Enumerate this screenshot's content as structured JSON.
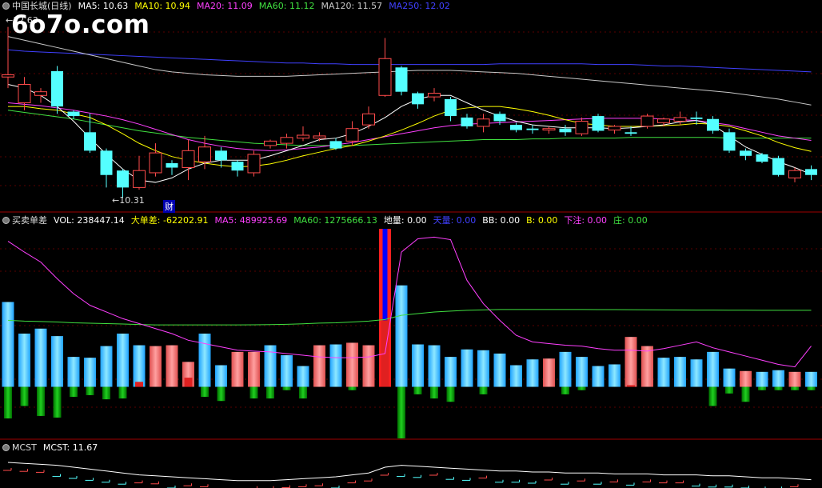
{
  "watermark": "6o7o.com",
  "colors": {
    "up": "#ff4b4b",
    "down": "#54ffff",
    "ma5": "#ffffff",
    "ma10": "#ffff00",
    "ma20": "#ff40ff",
    "ma60": "#40e040",
    "ma120": "#c8c8c8",
    "ma250": "#4040ff",
    "separator": "#a00000",
    "grid": "#5a0000"
  },
  "price_panel": {
    "stock": "中国长城(日线)",
    "indicators": [
      {
        "label": "MA5: 10.63",
        "color": "#ffffff"
      },
      {
        "label": "MA10: 10.94",
        "color": "#ffff00"
      },
      {
        "label": "MA20: 11.09",
        "color": "#ff40ff"
      },
      {
        "label": "MA60: 11.12",
        "color": "#40e040"
      },
      {
        "label": "MA120: 11.57",
        "color": "#c8c8c8"
      },
      {
        "label": "MA250: 12.02",
        "color": "#4040ff"
      }
    ],
    "high_label": "12.63",
    "low_label": "10.31",
    "event_marker": "财"
  },
  "volume_panel": {
    "name": "买卖单差",
    "indicators": [
      {
        "label": "VOL: 238447.14",
        "color": "#ffffff"
      },
      {
        "label": "大单差: -62202.91",
        "color": "#ffff00"
      },
      {
        "label": "MA5: 489925.69",
        "color": "#ff40ff"
      },
      {
        "label": "MA60: 1275666.13",
        "color": "#40e040"
      },
      {
        "label": "地量: 0.00",
        "color": "#ffffff"
      },
      {
        "label": "天量: 0.00",
        "color": "#4040ff"
      },
      {
        "label": "BB: 0.00",
        "color": "#ffffff"
      },
      {
        "label": "B: 0.00",
        "color": "#ffff00"
      },
      {
        "label": "下注: 0.00",
        "color": "#ff40ff"
      },
      {
        "label": "庄: 0.00",
        "color": "#40e040"
      }
    ]
  },
  "mcst_panel": {
    "name": "MCST",
    "indicators": [
      {
        "label": "MCST: 11.67",
        "color": "#ffffff"
      }
    ]
  },
  "chart_data": {
    "type": "candlestick",
    "price_range": [
      10.15,
      12.8
    ],
    "candles": [
      {
        "o": 11.95,
        "c": 11.98,
        "h": 12.63,
        "l": 11.8,
        "up": true
      },
      {
        "o": 11.6,
        "c": 11.85,
        "h": 11.95,
        "l": 11.5,
        "up": true
      },
      {
        "o": 11.7,
        "c": 11.75,
        "h": 11.8,
        "l": 11.6,
        "up": true
      },
      {
        "o": 12.03,
        "c": 11.55,
        "h": 12.1,
        "l": 11.45,
        "up": false
      },
      {
        "o": 11.48,
        "c": 11.42,
        "h": 11.5,
        "l": 11.38,
        "up": false
      },
      {
        "o": 11.2,
        "c": 10.95,
        "h": 11.45,
        "l": 10.92,
        "up": false
      },
      {
        "o": 10.95,
        "c": 10.62,
        "h": 10.98,
        "l": 10.45,
        "up": false
      },
      {
        "o": 10.68,
        "c": 10.45,
        "h": 10.7,
        "l": 10.31,
        "up": false
      },
      {
        "o": 10.45,
        "c": 10.68,
        "h": 10.88,
        "l": 10.42,
        "up": true
      },
      {
        "o": 10.65,
        "c": 10.92,
        "h": 11.05,
        "l": 10.6,
        "up": true
      },
      {
        "o": 10.78,
        "c": 10.72,
        "h": 10.82,
        "l": 10.62,
        "up": false
      },
      {
        "o": 10.72,
        "c": 10.95,
        "h": 11.1,
        "l": 10.55,
        "up": true
      },
      {
        "o": 10.8,
        "c": 11.0,
        "h": 11.15,
        "l": 10.7,
        "up": true
      },
      {
        "o": 10.95,
        "c": 10.82,
        "h": 11.0,
        "l": 10.72,
        "up": false
      },
      {
        "o": 10.8,
        "c": 10.68,
        "h": 10.82,
        "l": 10.6,
        "up": false
      },
      {
        "o": 10.65,
        "c": 10.9,
        "h": 10.95,
        "l": 10.6,
        "up": true
      },
      {
        "o": 11.02,
        "c": 11.08,
        "h": 11.1,
        "l": 10.98,
        "up": true
      },
      {
        "o": 11.05,
        "c": 11.13,
        "h": 11.18,
        "l": 10.98,
        "up": true
      },
      {
        "o": 11.12,
        "c": 11.16,
        "h": 11.28,
        "l": 11.08,
        "up": true
      },
      {
        "o": 11.12,
        "c": 11.15,
        "h": 11.2,
        "l": 11.08,
        "up": true
      },
      {
        "o": 11.08,
        "c": 10.98,
        "h": 11.12,
        "l": 10.96,
        "up": false
      },
      {
        "o": 11.08,
        "c": 11.25,
        "h": 11.35,
        "l": 11.02,
        "up": true
      },
      {
        "o": 11.3,
        "c": 11.45,
        "h": 11.55,
        "l": 11.25,
        "up": true
      },
      {
        "o": 11.7,
        "c": 12.2,
        "h": 12.48,
        "l": 11.68,
        "up": true
      },
      {
        "o": 12.08,
        "c": 11.75,
        "h": 12.1,
        "l": 11.7,
        "up": false
      },
      {
        "o": 11.73,
        "c": 11.58,
        "h": 11.75,
        "l": 11.52,
        "up": false
      },
      {
        "o": 11.68,
        "c": 11.73,
        "h": 11.8,
        "l": 11.62,
        "up": true
      },
      {
        "o": 11.65,
        "c": 11.42,
        "h": 11.68,
        "l": 11.35,
        "up": false
      },
      {
        "o": 11.4,
        "c": 11.28,
        "h": 11.45,
        "l": 11.25,
        "up": false
      },
      {
        "o": 11.28,
        "c": 11.38,
        "h": 11.45,
        "l": 11.2,
        "up": true
      },
      {
        "o": 11.45,
        "c": 11.35,
        "h": 11.48,
        "l": 11.3,
        "up": false
      },
      {
        "o": 11.3,
        "c": 11.23,
        "h": 11.33,
        "l": 11.2,
        "up": false
      },
      {
        "o": 11.25,
        "c": 11.23,
        "h": 11.3,
        "l": 11.18,
        "up": false
      },
      {
        "o": 11.23,
        "c": 11.25,
        "h": 11.28,
        "l": 11.18,
        "up": true
      },
      {
        "o": 11.25,
        "c": 11.2,
        "h": 11.3,
        "l": 11.15,
        "up": false
      },
      {
        "o": 11.18,
        "c": 11.35,
        "h": 11.4,
        "l": 11.15,
        "up": true
      },
      {
        "o": 11.42,
        "c": 11.22,
        "h": 11.45,
        "l": 11.2,
        "up": false
      },
      {
        "o": 11.23,
        "c": 11.28,
        "h": 11.3,
        "l": 11.18,
        "up": true
      },
      {
        "o": 11.2,
        "c": 11.18,
        "h": 11.28,
        "l": 11.15,
        "up": false
      },
      {
        "o": 11.28,
        "c": 11.42,
        "h": 11.45,
        "l": 11.25,
        "up": true
      },
      {
        "o": 11.33,
        "c": 11.38,
        "h": 11.4,
        "l": 11.28,
        "up": true
      },
      {
        "o": 11.35,
        "c": 11.4,
        "h": 11.48,
        "l": 11.3,
        "up": true
      },
      {
        "o": 11.4,
        "c": 11.38,
        "h": 11.48,
        "l": 11.3,
        "up": false
      },
      {
        "o": 11.38,
        "c": 11.22,
        "h": 11.42,
        "l": 11.18,
        "up": false
      },
      {
        "o": 11.2,
        "c": 10.95,
        "h": 11.25,
        "l": 10.92,
        "up": false
      },
      {
        "o": 10.95,
        "c": 10.88,
        "h": 10.98,
        "l": 10.82,
        "up": false
      },
      {
        "o": 10.9,
        "c": 10.8,
        "h": 10.92,
        "l": 10.78,
        "up": false
      },
      {
        "o": 10.85,
        "c": 10.62,
        "h": 10.88,
        "l": 10.6,
        "up": false
      },
      {
        "o": 10.58,
        "c": 10.68,
        "h": 10.72,
        "l": 10.52,
        "up": true
      },
      {
        "o": 10.7,
        "c": 10.62,
        "h": 10.75,
        "l": 10.55,
        "up": false
      }
    ],
    "ma_price": {
      "ma5": [
        11.85,
        11.8,
        11.7,
        11.55,
        11.35,
        11.12,
        10.9,
        10.7,
        10.55,
        10.52,
        10.58,
        10.7,
        10.78,
        10.82,
        10.82,
        10.82,
        10.88,
        10.95,
        11.02,
        11.1,
        11.12,
        11.18,
        11.28,
        11.4,
        11.55,
        11.65,
        11.7,
        11.7,
        11.6,
        11.5,
        11.42,
        11.35,
        11.3,
        11.28,
        11.26,
        11.26,
        11.26,
        11.25,
        11.26,
        11.28,
        11.3,
        11.34,
        11.36,
        11.3,
        11.15,
        11.0,
        10.9,
        10.8,
        10.72,
        10.63
      ],
      "ma10": [
        11.55,
        11.55,
        11.52,
        11.5,
        11.45,
        11.4,
        11.3,
        11.18,
        11.05,
        10.95,
        10.87,
        10.82,
        10.78,
        10.75,
        10.73,
        10.74,
        10.77,
        10.82,
        10.88,
        10.93,
        10.98,
        11.02,
        11.08,
        11.15,
        11.23,
        11.32,
        11.42,
        11.5,
        11.53,
        11.55,
        11.55,
        11.52,
        11.48,
        11.43,
        11.37,
        11.32,
        11.3,
        11.28,
        11.28,
        11.28,
        11.29,
        11.3,
        11.32,
        11.31,
        11.28,
        11.22,
        11.15,
        11.06,
        10.99,
        10.94
      ],
      "ma20": [
        11.6,
        11.58,
        11.56,
        11.53,
        11.5,
        11.46,
        11.42,
        11.37,
        11.31,
        11.24,
        11.17,
        11.1,
        11.05,
        11.01,
        10.98,
        10.96,
        10.95,
        10.96,
        10.98,
        11.0,
        11.03,
        11.06,
        11.1,
        11.14,
        11.18,
        11.22,
        11.26,
        11.29,
        11.31,
        11.32,
        11.33,
        11.34,
        11.35,
        11.36,
        11.37,
        11.38,
        11.39,
        11.39,
        11.39,
        11.39,
        11.38,
        11.37,
        11.36,
        11.33,
        11.3,
        11.25,
        11.2,
        11.15,
        11.12,
        11.09
      ],
      "ma60": [
        11.5,
        11.47,
        11.44,
        11.41,
        11.38,
        11.34,
        11.3,
        11.26,
        11.22,
        11.19,
        11.16,
        11.13,
        11.11,
        11.09,
        11.07,
        11.05,
        11.04,
        11.03,
        11.02,
        11.02,
        11.02,
        11.02,
        11.03,
        11.04,
        11.05,
        11.06,
        11.07,
        11.08,
        11.09,
        11.1,
        11.1,
        11.1,
        11.11,
        11.11,
        11.12,
        11.12,
        11.12,
        11.12,
        11.13,
        11.13,
        11.13,
        11.13,
        11.13,
        11.13,
        11.12,
        11.12,
        11.12,
        11.12,
        11.12,
        11.12
      ],
      "ma120": [
        12.5,
        12.45,
        12.4,
        12.35,
        12.3,
        12.25,
        12.2,
        12.15,
        12.1,
        12.05,
        12.02,
        12.0,
        11.98,
        11.97,
        11.96,
        11.96,
        11.96,
        11.96,
        11.97,
        11.98,
        11.99,
        12.0,
        12.01,
        12.02,
        12.03,
        12.04,
        12.04,
        12.04,
        12.03,
        12.02,
        12.01,
        12.0,
        11.98,
        11.96,
        11.94,
        11.92,
        11.9,
        11.88,
        11.86,
        11.84,
        11.82,
        11.8,
        11.78,
        11.76,
        11.74,
        11.71,
        11.68,
        11.65,
        11.61,
        11.57
      ],
      "ma250": [
        12.32,
        12.3,
        12.29,
        12.28,
        12.27,
        12.26,
        12.25,
        12.24,
        12.23,
        12.22,
        12.21,
        12.2,
        12.19,
        12.18,
        12.17,
        12.16,
        12.15,
        12.14,
        12.14,
        12.13,
        12.13,
        12.12,
        12.12,
        12.12,
        12.12,
        12.12,
        12.12,
        12.12,
        12.12,
        12.12,
        12.13,
        12.13,
        12.13,
        12.13,
        12.13,
        12.13,
        12.12,
        12.12,
        12.12,
        12.11,
        12.1,
        12.1,
        12.09,
        12.08,
        12.07,
        12.06,
        12.05,
        12.04,
        12.03,
        12.02
      ]
    },
    "volume_range": [
      -620000,
      1900000
    ],
    "volume_bars": [
      1020000,
      640000,
      700000,
      610000,
      360000,
      350000,
      490000,
      640000,
      500000,
      490000,
      500000,
      300000,
      640000,
      260000,
      420000,
      420000,
      500000,
      380000,
      250000,
      500000,
      510000,
      530000,
      500000,
      1900000,
      1220000,
      510000,
      500000,
      360000,
      450000,
      440000,
      400000,
      260000,
      330000,
      340000,
      420000,
      360000,
      250000,
      270000,
      600000,
      490000,
      350000,
      360000,
      330000,
      420000,
      220000,
      190000,
      180000,
      200000,
      180000,
      180000
    ],
    "volume_bar_up": [
      false,
      false,
      false,
      false,
      false,
      false,
      false,
      false,
      false,
      true,
      true,
      true,
      false,
      false,
      true,
      true,
      false,
      false,
      false,
      true,
      false,
      true,
      true,
      true,
      false,
      false,
      false,
      false,
      false,
      false,
      false,
      false,
      false,
      true,
      false,
      false,
      false,
      false,
      true,
      true,
      false,
      false,
      false,
      false,
      false,
      true,
      false,
      false,
      true,
      false
    ],
    "big_order_diff": [
      -380000,
      -230000,
      -350000,
      -370000,
      -120000,
      -100000,
      -150000,
      -140000,
      60000,
      0,
      0,
      110000,
      -120000,
      -170000,
      0,
      -140000,
      -140000,
      -40000,
      -140000,
      0,
      0,
      -40000,
      0,
      800000,
      -620000,
      -90000,
      -140000,
      -180000,
      0,
      -90000,
      0,
      0,
      0,
      0,
      -90000,
      -40000,
      0,
      0,
      20000,
      0,
      0,
      0,
      0,
      -230000,
      -80000,
      -180000,
      -40000,
      -40000,
      -40000,
      -40000
    ],
    "vol_ma5": [
      1750000,
      1620000,
      1500000,
      1300000,
      1120000,
      980000,
      900000,
      820000,
      760000,
      700000,
      640000,
      560000,
      520000,
      480000,
      440000,
      430000,
      420000,
      400000,
      380000,
      360000,
      350000,
      350000,
      360000,
      400000,
      1620000,
      1780000,
      1800000,
      1770000,
      1280000,
      1000000,
      800000,
      620000,
      540000,
      520000,
      500000,
      490000,
      460000,
      440000,
      440000,
      430000,
      460000,
      500000,
      540000,
      470000,
      420000,
      370000,
      320000,
      270000,
      240000,
      489925.69
    ],
    "vol_ma60": [
      800000,
      790000,
      785000,
      780000,
      770000,
      765000,
      760000,
      755000,
      750000,
      745000,
      745000,
      745000,
      745000,
      745000,
      745000,
      746000,
      748000,
      752000,
      758000,
      766000,
      770000,
      780000,
      790000,
      810000,
      860000,
      880000,
      900000,
      910000,
      920000,
      925000,
      930000,
      930000,
      930000,
      930000,
      930000,
      930000,
      929000,
      928000,
      927000,
      926000,
      925000,
      924000,
      923000,
      922000,
      921000,
      921000,
      920000,
      920000,
      920000,
      920000
    ],
    "mcst": [
      11.85,
      11.84,
      11.83,
      11.82,
      11.8,
      11.78,
      11.76,
      11.74,
      11.72,
      11.71,
      11.7,
      11.69,
      11.68,
      11.67,
      11.66,
      11.66,
      11.66,
      11.67,
      11.68,
      11.69,
      11.7,
      11.72,
      11.74,
      11.8,
      11.82,
      11.81,
      11.8,
      11.79,
      11.78,
      11.77,
      11.76,
      11.76,
      11.75,
      11.75,
      11.74,
      11.74,
      11.74,
      11.73,
      11.73,
      11.73,
      11.72,
      11.72,
      11.72,
      11.71,
      11.71,
      11.7,
      11.69,
      11.69,
      11.68,
      11.67
    ]
  }
}
